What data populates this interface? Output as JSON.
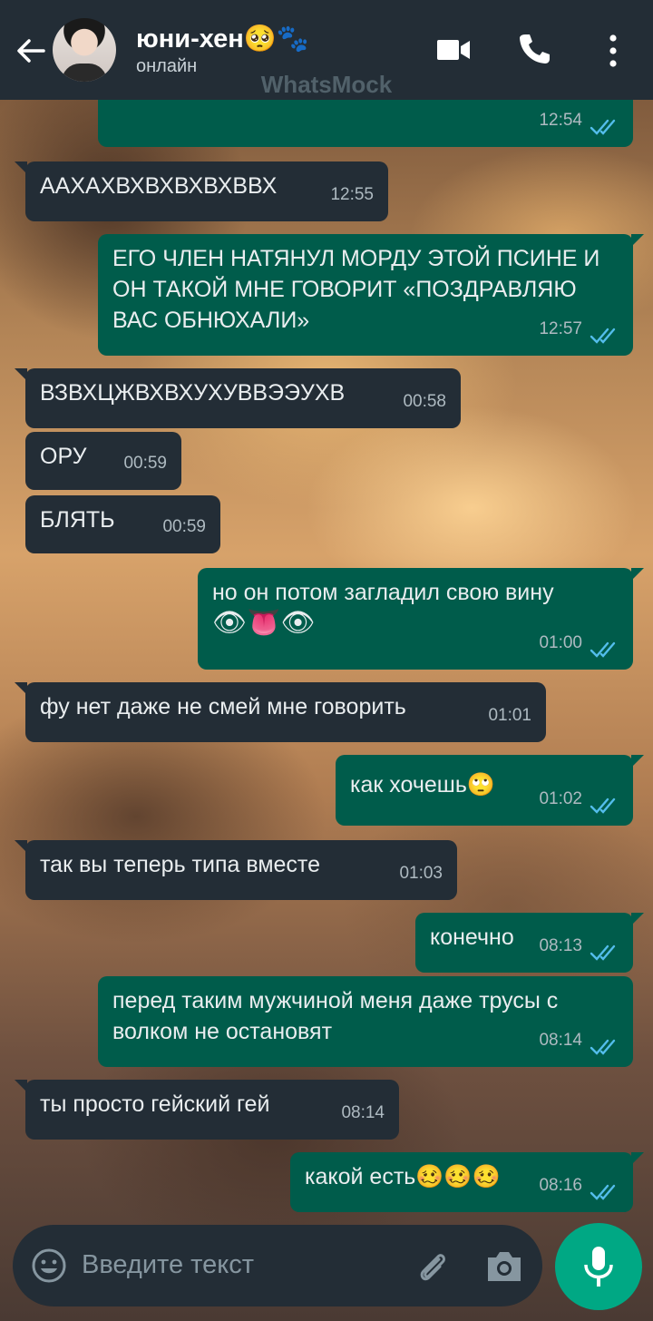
{
  "header": {
    "contact_name": "юни-хен🥺🐾",
    "status": "онлайн",
    "watermark": "WhatsMock"
  },
  "messages": [
    {
      "dir": "out",
      "text": "",
      "time": "12:54",
      "ticks": "read"
    },
    {
      "dir": "in",
      "text": "ААХАХВХВХВХВХВВХ",
      "time": "12:55"
    },
    {
      "dir": "out",
      "text": "ЕГО ЧЛЕН НАТЯНУЛ МОРДУ ЭТОЙ ПСИНЕ И ОН ТАКОЙ МНЕ ГОВОРИТ «ПОЗДРАВЛЯЮ ВАС ОБНЮХАЛИ»",
      "time": "12:57",
      "ticks": "read"
    },
    {
      "dir": "in",
      "text": "ВЗВХЦЖВХВХУХУВВЭЭУХВ",
      "time": "00:58"
    },
    {
      "dir": "in",
      "text": "ОРУ",
      "time": "00:59"
    },
    {
      "dir": "in",
      "text": "БЛЯТЬ",
      "time": "00:59"
    },
    {
      "dir": "out",
      "text": "но он потом загладил свою вину",
      "emoji": "👁👅👁",
      "time": "01:00",
      "ticks": "read"
    },
    {
      "dir": "in",
      "text": "фу нет даже не смей мне говорить",
      "time": "01:01"
    },
    {
      "dir": "out",
      "text": "как хочешь🙄",
      "time": "01:02",
      "ticks": "read"
    },
    {
      "dir": "in",
      "text": "так вы теперь типа вместе",
      "time": "01:03"
    },
    {
      "dir": "out",
      "text": "конечно",
      "time": "08:13",
      "ticks": "read"
    },
    {
      "dir": "out",
      "text": "перед таким мужчиной меня даже трусы с волком не остановят",
      "time": "08:14",
      "ticks": "read"
    },
    {
      "dir": "in",
      "text": "ты просто гейский гей",
      "time": "08:14"
    },
    {
      "dir": "out",
      "text": "какой есть🥴🥴🥴",
      "time": "08:16",
      "ticks": "read"
    }
  ],
  "input": {
    "placeholder": "Введите текст"
  },
  "colors": {
    "header_bg": "#232d36",
    "incoming_bubble": "#232d36",
    "outgoing_bubble": "#005c4b",
    "read_ticks": "#53bdeb",
    "mic_button": "#00a884"
  },
  "icons": [
    "back-arrow-icon",
    "video-call-icon",
    "phone-icon",
    "more-vert-icon",
    "emoji-icon",
    "attach-icon",
    "camera-icon",
    "mic-icon",
    "double-check-icon"
  ]
}
